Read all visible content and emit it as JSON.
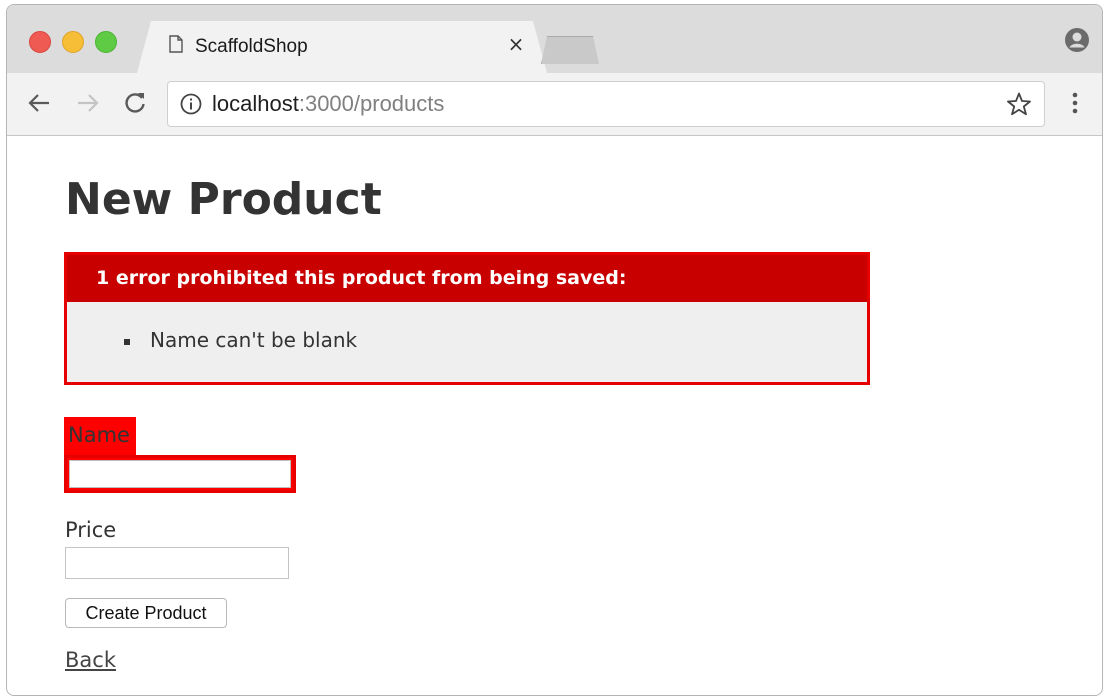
{
  "tab": {
    "title": "ScaffoldShop",
    "close_symbol": "×",
    "icon": "page-icon"
  },
  "toolbar": {
    "url_host": "localhost",
    "url_rest": ":3000/products",
    "icons": [
      "back-arrow-icon",
      "forward-arrow-icon",
      "reload-icon",
      "info-icon",
      "star-icon",
      "menu-icon",
      "profile-icon"
    ]
  },
  "page": {
    "title": "New Product",
    "error_header": "1 error prohibited this product from being saved:",
    "errors": [
      "Name can't be blank"
    ],
    "name_label": "Name",
    "name_value": "",
    "price_label": "Price",
    "price_value": "",
    "submit_label": "Create Product",
    "back_link": "Back"
  },
  "colors": {
    "error_header_bg": "#c80000",
    "error_border": "#e60000",
    "field_error_bg": "#ff0000",
    "error_box_bg": "#efefef"
  }
}
